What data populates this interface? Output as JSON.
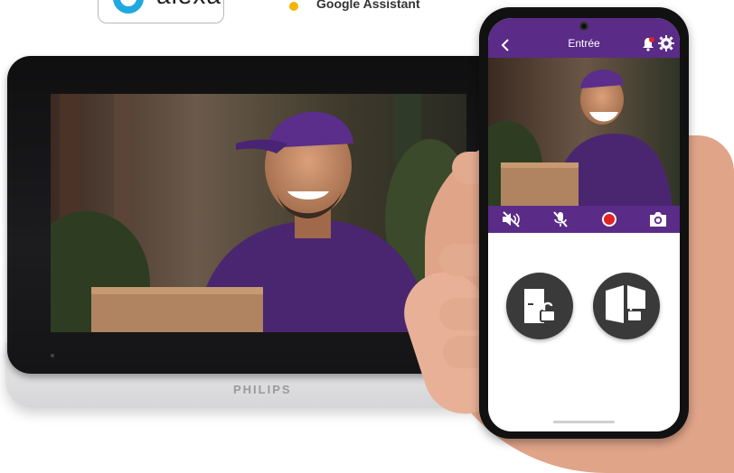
{
  "logos": {
    "alexa_text": "alexa",
    "google_assistant_text": "Google Assistant"
  },
  "monitor": {
    "brand": "PHILIPS"
  },
  "phone_app": {
    "title": "Entrée",
    "icons": {
      "back": "chevron-left-icon",
      "notification": "bell-icon",
      "settings": "gear-icon",
      "mute": "speaker-mute-icon",
      "microphone": "microphone-mute-icon",
      "record": "record-icon",
      "snapshot": "camera-icon",
      "unlock_door": "door-unlock-icon",
      "unlock_gate": "gate-unlock-icon"
    },
    "colors": {
      "accent": "#5b2b88",
      "record": "#e02424",
      "button_dark": "#3a3a3a"
    }
  }
}
